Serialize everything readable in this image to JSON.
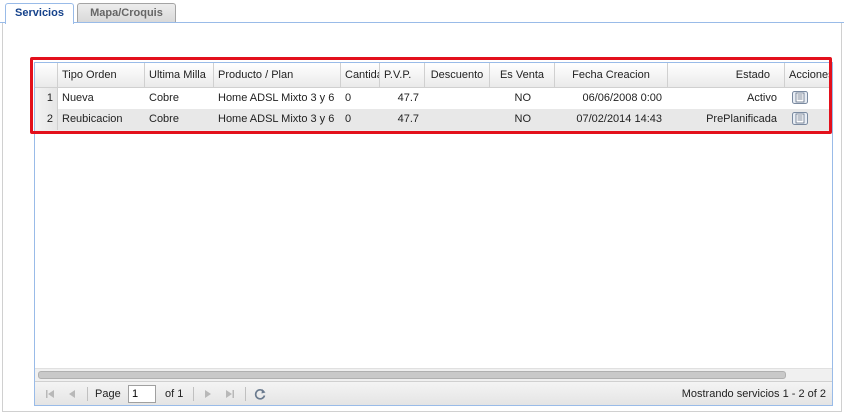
{
  "tabs": {
    "servicios": "Servicios",
    "mapa": "Mapa/Croquis"
  },
  "grid": {
    "columns": {
      "tipo_orden": "Tipo Orden",
      "ultima_milla": "Ultima Milla",
      "producto": "Producto / Plan",
      "cantidad": "Cantidad",
      "pvp": "P.V.P.",
      "descuento": "Descuento",
      "es_venta": "Es Venta",
      "fecha": "Fecha Creacion",
      "estado": "Estado",
      "acciones": "Acciones"
    },
    "rows": [
      {
        "num": "1",
        "tipo_orden": "Nueva",
        "ultima_milla": "Cobre",
        "producto": "Home ADSL Mixto 3 y 6",
        "cantidad": "0",
        "pvp": "47.7",
        "descuento": "",
        "es_venta": "NO",
        "fecha": "06/06/2008 0:00",
        "estado": "Activo",
        "accion_icon": "document-icon"
      },
      {
        "num": "2",
        "tipo_orden": "Reubicacion",
        "ultima_milla": "Cobre",
        "producto": "Home ADSL Mixto 3 y 6",
        "cantidad": "0",
        "pvp": "47.7",
        "descuento": "",
        "es_venta": "NO",
        "fecha": "07/02/2014 14:43",
        "estado": "PrePlanificada",
        "accion_icon": "document-icon"
      }
    ]
  },
  "pager": {
    "page_label": "Page",
    "page_value": "1",
    "of_label": "of 1",
    "status": "Mostrando servicios 1 - 2 of 2"
  },
  "colors": {
    "highlight": "#e3101c",
    "tab_text": "#15428b",
    "grid_border": "#99bbe8"
  }
}
